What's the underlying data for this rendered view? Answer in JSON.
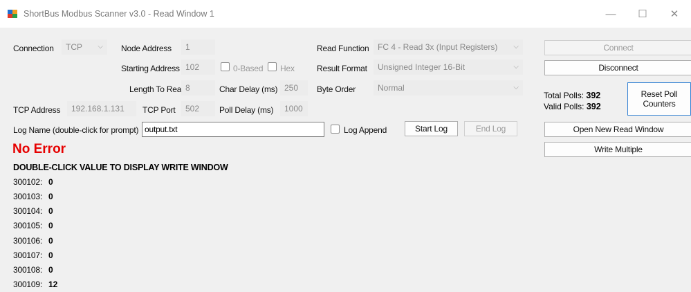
{
  "window": {
    "title": "ShortBus Modbus Scanner v3.0 - Read Window 1",
    "minimize_glyph": "—",
    "maximize_glyph": "☐",
    "close_glyph": "✕"
  },
  "connection": {
    "label": "Connection",
    "value": "TCP",
    "chevron": "⌵"
  },
  "node_address": {
    "label": "Node Address",
    "value": "1"
  },
  "starting_address": {
    "label": "Starting Address",
    "value": "102"
  },
  "zero_based": {
    "label": "0-Based"
  },
  "hex": {
    "label": "Hex"
  },
  "length_to_read": {
    "label": "Length To Read",
    "value": "8"
  },
  "char_delay": {
    "label": "Char Delay (ms)",
    "value": "250"
  },
  "tcp_address": {
    "label": "TCP Address",
    "value": "192.168.1.131"
  },
  "tcp_port": {
    "label": "TCP Port",
    "value": "502"
  },
  "poll_delay": {
    "label": "Poll Delay (ms)",
    "value": "1000"
  },
  "read_function": {
    "label": "Read Function",
    "value": "FC 4 - Read 3x (Input Registers)"
  },
  "result_format": {
    "label": "Result Format",
    "value": "Unsigned Integer 16-Bit"
  },
  "byte_order": {
    "label": "Byte Order",
    "value": "Normal"
  },
  "log": {
    "name_label": "Log Name (double-click for prompt)",
    "name_value": "output.txt",
    "append_label": "Log Append",
    "start_label": "Start Log",
    "end_label": "End Log"
  },
  "buttons": {
    "connect": "Connect",
    "disconnect": "Disconnect",
    "reset_poll_counters_line1": "Reset Poll",
    "reset_poll_counters_line2": "Counters",
    "open_new_read_window": "Open New Read Window",
    "write_multiple": "Write Multiple"
  },
  "polls": {
    "total_label": "Total Polls:",
    "total_value": "392",
    "valid_label": "Valid Polls:",
    "valid_value": "392"
  },
  "status": {
    "error_text": "No Error"
  },
  "instruction": "DOUBLE-CLICK VALUE TO DISPLAY WRITE WINDOW",
  "registers": [
    {
      "address": "300102:",
      "value": "0"
    },
    {
      "address": "300103:",
      "value": "0"
    },
    {
      "address": "300104:",
      "value": "0"
    },
    {
      "address": "300105:",
      "value": "0"
    },
    {
      "address": "300106:",
      "value": "0"
    },
    {
      "address": "300107:",
      "value": "0"
    },
    {
      "address": "300108:",
      "value": "0"
    },
    {
      "address": "300109:",
      "value": "12"
    }
  ],
  "colors": {
    "error_text": "#e60000",
    "background": "#f0f0f0",
    "titlebar": "#ffffff"
  }
}
